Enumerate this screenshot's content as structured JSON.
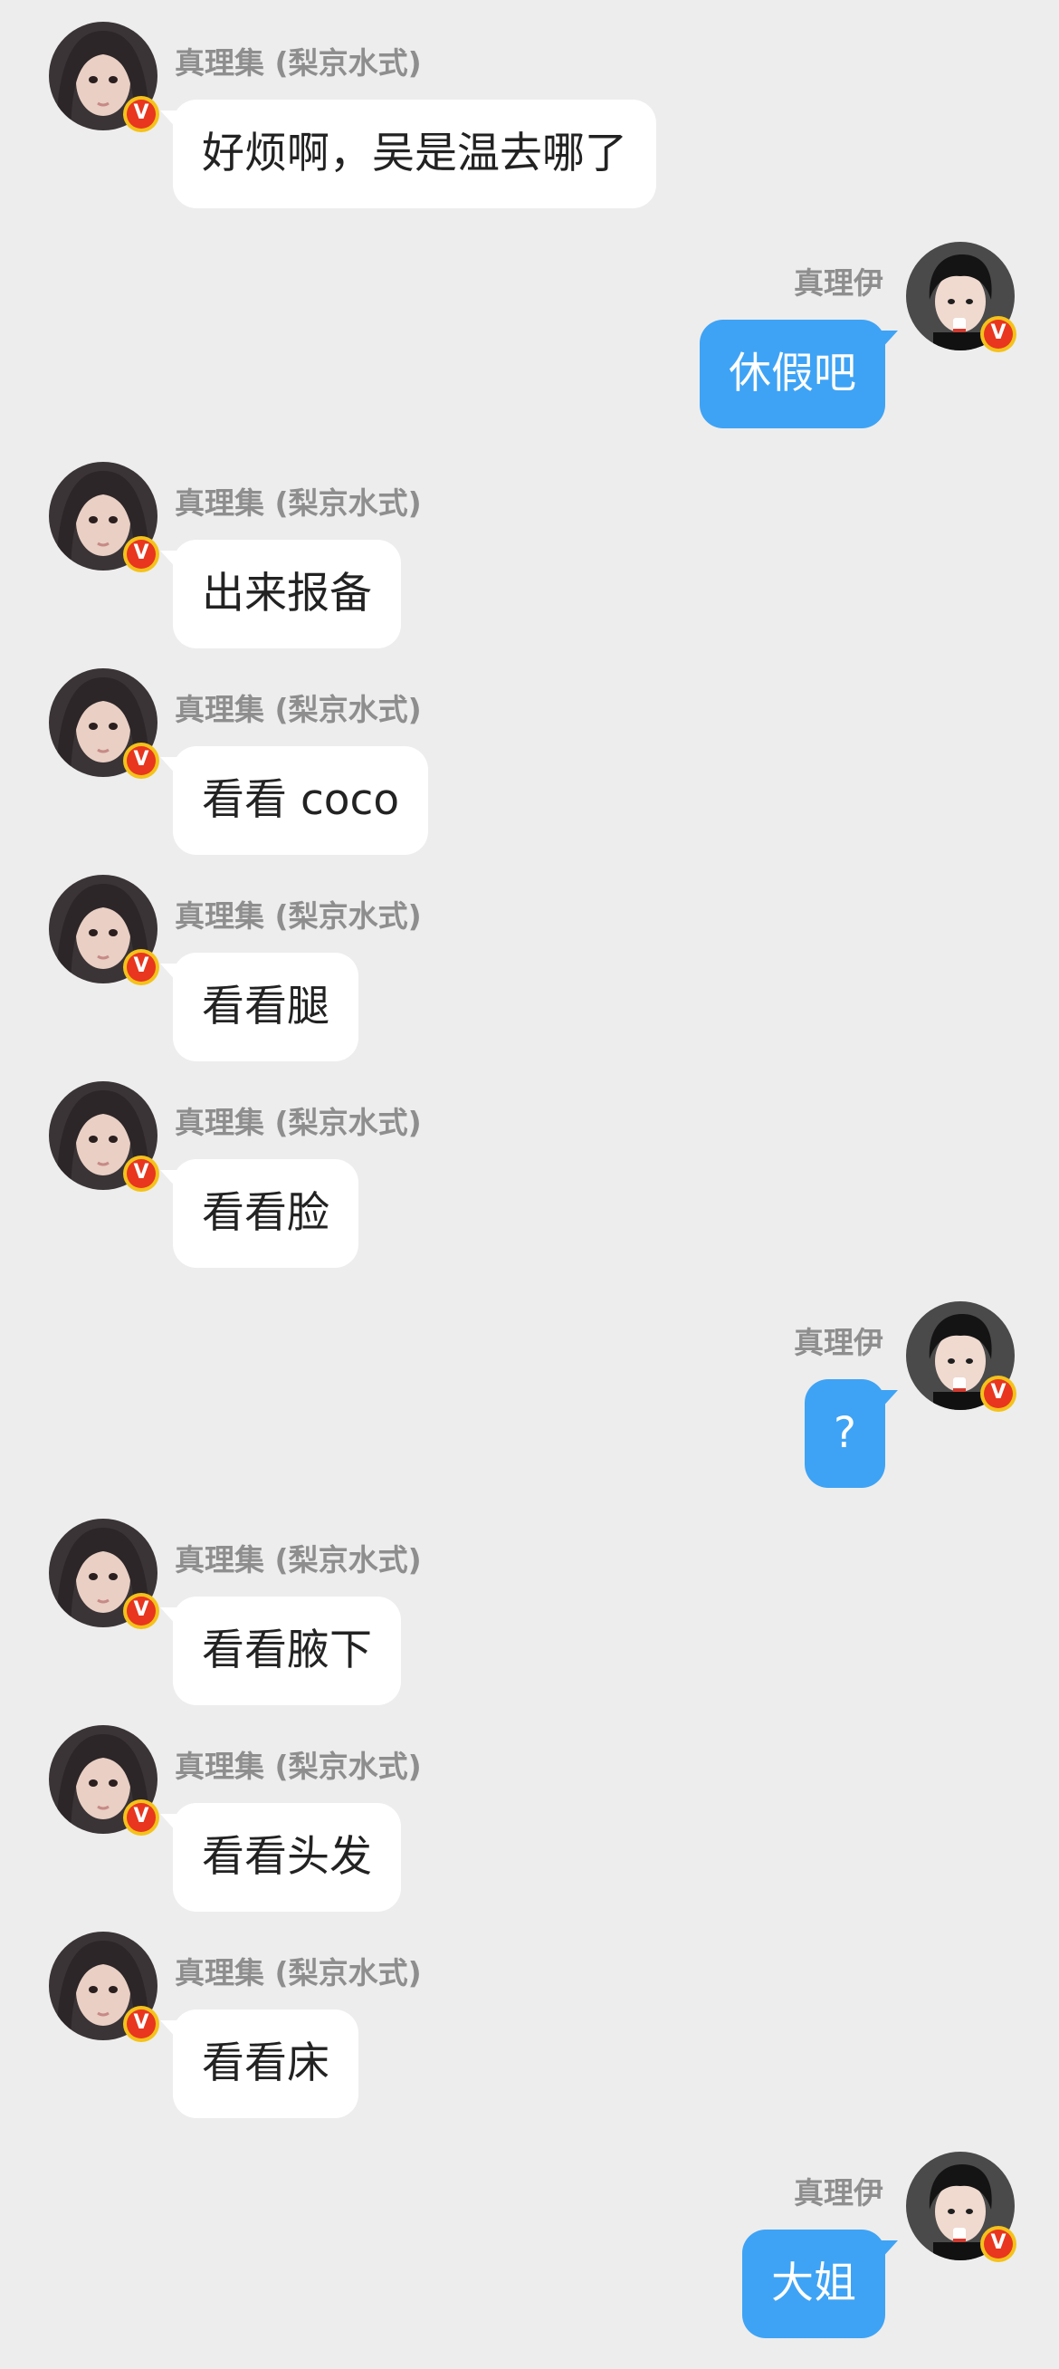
{
  "contacts": {
    "other": {
      "name": "真理集 (梨京水式)",
      "badge": "V",
      "badge_color": "#e8361f",
      "badge_ring": "#f4c21a"
    },
    "self": {
      "name": "真理伊",
      "badge": "V",
      "badge_color": "#e8361f",
      "badge_ring": "#f4c21a"
    }
  },
  "colors": {
    "background": "#ededed",
    "incoming_bubble": "#ffffff",
    "outgoing_bubble": "#3ea3f5",
    "sender_name": "#8e8e8e"
  },
  "messages": [
    {
      "side": "left",
      "sender": "真理集 (梨京水式)",
      "text": "好烦啊，吴是温去哪了"
    },
    {
      "side": "right",
      "sender": "真理伊",
      "text": "休假吧"
    },
    {
      "side": "left",
      "sender": "真理集 (梨京水式)",
      "text": "出来报备"
    },
    {
      "side": "left",
      "sender": "真理集 (梨京水式)",
      "text": "看看 coco"
    },
    {
      "side": "left",
      "sender": "真理集 (梨京水式)",
      "text": "看看腿"
    },
    {
      "side": "left",
      "sender": "真理集 (梨京水式)",
      "text": "看看脸"
    },
    {
      "side": "right",
      "sender": "真理伊",
      "text": "?"
    },
    {
      "side": "left",
      "sender": "真理集 (梨京水式)",
      "text": "看看腋下"
    },
    {
      "side": "left",
      "sender": "真理集 (梨京水式)",
      "text": "看看头发"
    },
    {
      "side": "left",
      "sender": "真理集 (梨京水式)",
      "text": "看看床"
    },
    {
      "side": "right",
      "sender": "真理伊",
      "text": "大姐"
    }
  ]
}
